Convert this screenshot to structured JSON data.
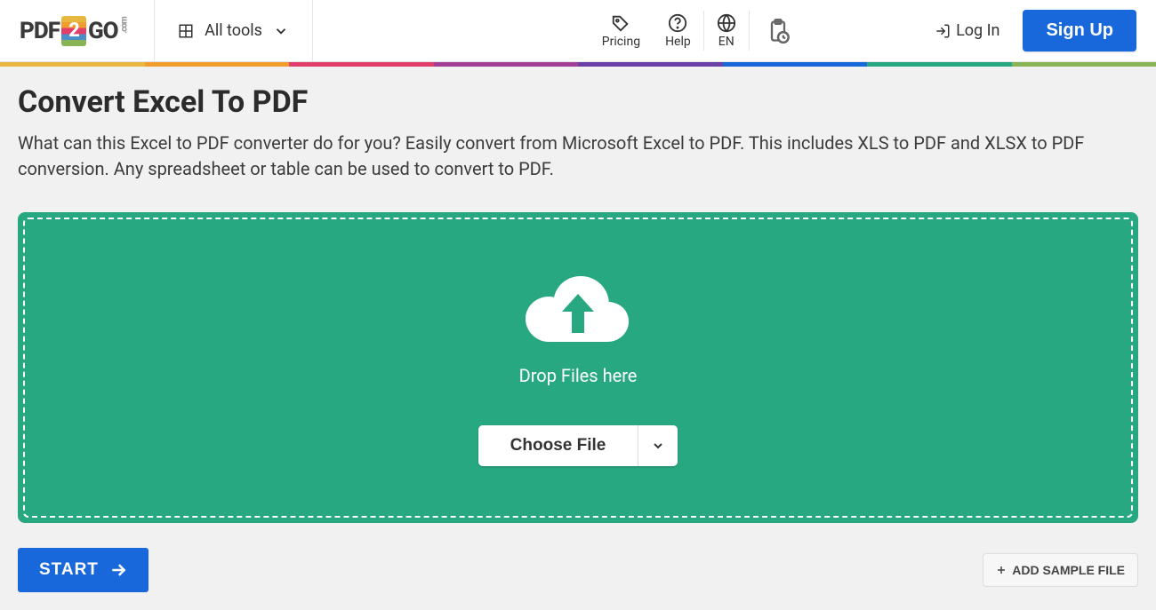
{
  "header": {
    "logo_left": "PDF",
    "logo_badge": "2",
    "logo_right": "GO",
    "logo_suffix": ".com",
    "all_tools_label": "All tools",
    "pricing_label": "Pricing",
    "help_label": "Help",
    "lang_label": "EN",
    "login_label": "Log In",
    "signup_label": "Sign Up"
  },
  "rainbow_colors": [
    "#e8b73f",
    "#f09c2e",
    "#e23e6c",
    "#a33e96",
    "#6a40a7",
    "#1868db",
    "#27a881",
    "#88b453"
  ],
  "page": {
    "title": "Convert Excel To PDF",
    "description": "What can this Excel to PDF converter do for you? Easily convert from Microsoft Excel to PDF. This includes XLS to PDF and XLSX to PDF conversion. Any spreadsheet or table can be used to convert to PDF."
  },
  "dropzone": {
    "drop_text": "Drop Files here",
    "choose_label": "Choose File"
  },
  "actions": {
    "start_label": "START",
    "sample_label": "ADD SAMPLE FILE"
  }
}
